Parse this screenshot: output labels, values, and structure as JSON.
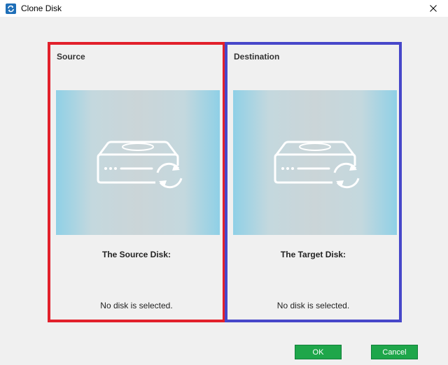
{
  "window": {
    "title": "Clone Disk",
    "icons": {
      "app": "clone-app-icon",
      "close": "close-icon"
    }
  },
  "source": {
    "header": "Source",
    "disk_label": "The Source Disk:",
    "status": "No disk is selected.",
    "icon": "disk-clone-icon",
    "border_color": "#e2202b"
  },
  "destination": {
    "header": "Destination",
    "disk_label": "The Target Disk:",
    "status": "No disk is selected.",
    "icon": "disk-clone-icon",
    "border_color": "#4747c9"
  },
  "buttons": {
    "ok_label": "OK",
    "cancel_label": "Cancel",
    "color": "#1ea64a"
  }
}
